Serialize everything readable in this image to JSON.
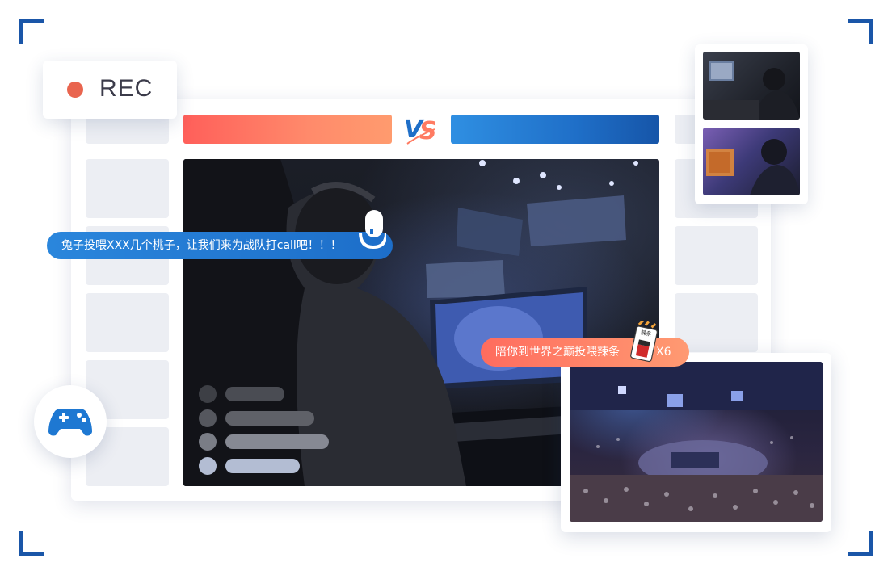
{
  "recorder": {
    "label": "REC",
    "dot_color": "#e9654f"
  },
  "versus": {
    "label": "VS",
    "left_team_color": "#ff7b62",
    "right_team_color": "#1f6fc8"
  },
  "comments": {
    "danmaku_blue": "兔子投喂XXX几个桃子，让我们来为战队打call吧！！！",
    "danmaku_orange": "陪你到世界之巅投喂辣条",
    "gift_count": "X6",
    "gift_label": "辣条"
  },
  "icons": {
    "record": "record-dot-icon",
    "vs": "vs-logo-icon",
    "mic": "microphone-icon",
    "gift": "chili-snack-icon",
    "controller": "gamepad-icon"
  },
  "chat_rows": [
    {
      "dot": "#3d3f45",
      "bar": "#4a4c53"
    },
    {
      "dot": "#55575e",
      "bar": "#5f6168"
    },
    {
      "dot": "#7a7d86",
      "bar": "#868993"
    },
    {
      "dot": "#b3bdd3",
      "bar": "#b3bdd3"
    }
  ]
}
